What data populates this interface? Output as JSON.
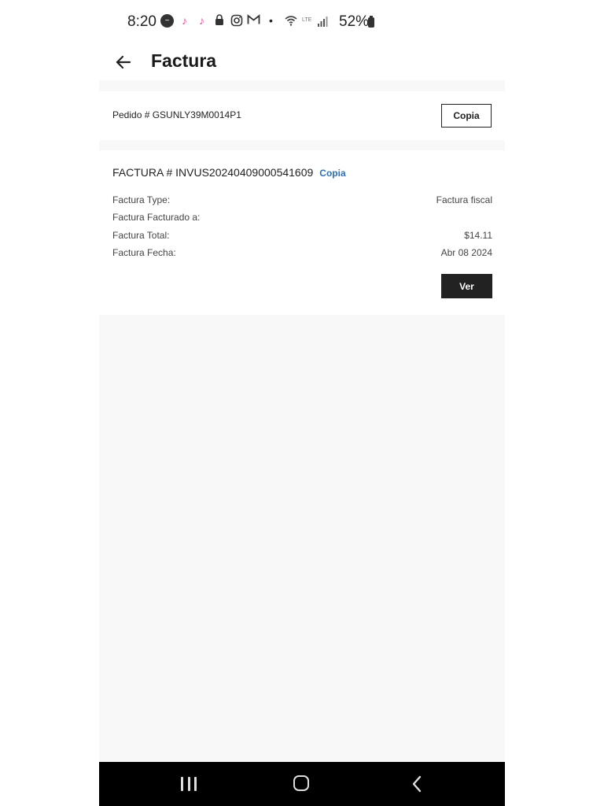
{
  "status_bar": {
    "time": "8:20",
    "battery": "52%",
    "icons": [
      "messenger-icon",
      "tiktok-icon",
      "tiktok-icon",
      "lock-icon",
      "instagram-icon",
      "gmail-icon",
      "dot-icon",
      "wifi-icon",
      "signal-icon",
      "battery-icon"
    ]
  },
  "header": {
    "title": "Factura"
  },
  "order": {
    "label": "Pedido # GSUNLY39M0014P1",
    "copy_label": "Copia"
  },
  "invoice": {
    "title": "FACTURA # INVUS20240409000541609",
    "copy_link": "Copia",
    "rows": [
      {
        "key": "Factura Type:",
        "value": "Factura fiscal"
      },
      {
        "key": "Factura Facturado a:",
        "value": ""
      },
      {
        "key": "Factura Total:",
        "value": "$14.11"
      },
      {
        "key": "Factura Fecha:",
        "value": "Abr 08 2024"
      }
    ],
    "view_label": "Ver"
  },
  "colors": {
    "link": "#2d6fb3",
    "button_dark": "#222222",
    "nav_bar": "#000000",
    "background": "#f8f8f8"
  }
}
